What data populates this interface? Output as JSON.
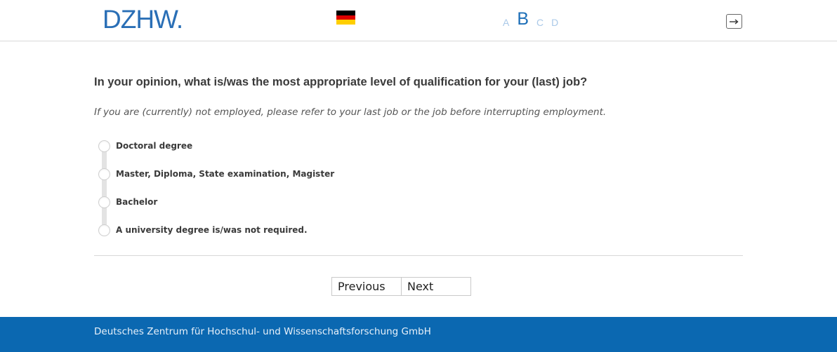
{
  "header": {
    "logo_text": "DZHW.",
    "language_flag": "germany-flag",
    "font_size_options": [
      "A",
      "B",
      "C",
      "D"
    ],
    "exit_icon": "exit-arrow-icon"
  },
  "main": {
    "question": "In your opinion, what is/was the most appropriate level of qualification for your (last) job?",
    "instruction": "If you are (currently) not employed, please refer to your last job or the job before interrupting employment.",
    "options": [
      "Doctoral degree",
      "Master, Diploma, State examination, Magister",
      "Bachelor",
      "A university degree is/was not required."
    ]
  },
  "navigation": {
    "previous_label": "Previous",
    "next_label": "Next"
  },
  "footer": {
    "text": "Deutsches Zentrum für Hochschul- und Wissenschaftsforschung GmbH"
  },
  "colors": {
    "brand_blue": "#2a6fb6",
    "footer_blue": "#0b68b1",
    "active_font_letter": "#1d6fb8",
    "inactive_font_letter": "#aac9e8"
  }
}
